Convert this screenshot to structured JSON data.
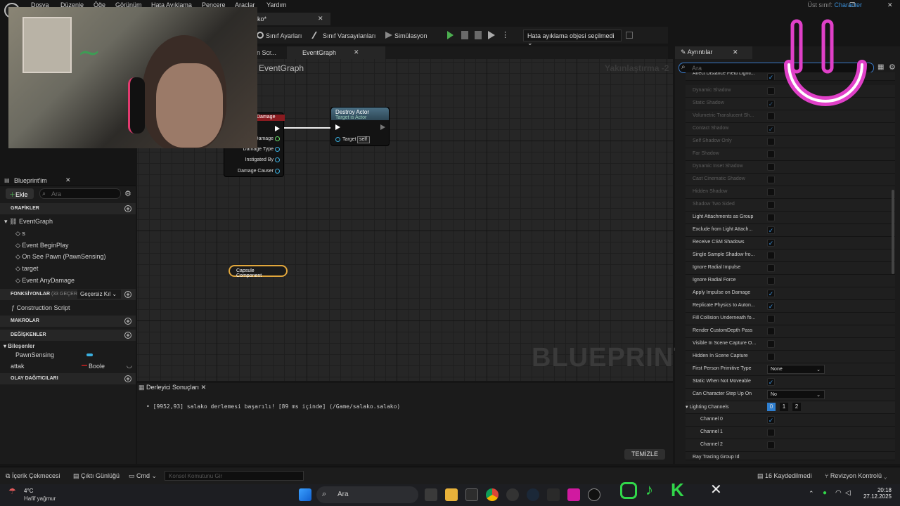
{
  "menu": [
    "Dosya",
    "Düzenle",
    "Öğe",
    "Görünüm",
    "Hata Ayıklama",
    "Pencere",
    "Araçlar",
    "Yardım"
  ],
  "parent_class": {
    "label": "Üst sınıf:",
    "value": "Character"
  },
  "doc_tab": "ko*",
  "toolbar": {
    "class_settings": "Sınıf Ayarları",
    "class_defaults": "Sınıf Varsayılanları",
    "simulation": "Simülasyon",
    "debug_object": "Hata ayıklama objesi seçilmedi"
  },
  "graph_tabs": [
    "on Scr...",
    "EventGraph"
  ],
  "graph": {
    "title": "EventGraph",
    "zoom": "Yakınlaştırma -2",
    "watermark": "BLUEPRINT",
    "nodes": {
      "destroy_title": "Destroy Actor",
      "destroy_sub": "Target is Actor",
      "target_label": "Target",
      "target_value": "self",
      "damage_header": "Damage",
      "damage_pins": [
        "Damage",
        "Damage Type",
        "Instigated By",
        "Damage Causer"
      ],
      "capsule": "Capsule Component"
    }
  },
  "left": {
    "tab": "Blueprint'im",
    "add": "Ekle",
    "search_placeholder": "Ara",
    "graphs_header": "GRAFİKLER",
    "event_graph": "EventGraph",
    "graph_items": [
      "s",
      "Event BeginPlay",
      "On See Pawn (PawnSensing)",
      "target",
      "Event AnyDamage"
    ],
    "functions_header": "FONKSİYONLAR",
    "functions_count": "(33 GEÇERSİZ)",
    "override": "Geçersiz Kıl",
    "construction": "Construction Script",
    "macros": "MAKROLAR",
    "variables": "DEĞİŞKENLER",
    "components": "Bileşenler",
    "pawnsensing": "PawnSensing",
    "attak": "attak",
    "attak_type": "Boole",
    "dispatchers": "OLAY DAĞITICILARI"
  },
  "output": {
    "tab": "Derleyici Sonuçları",
    "line": "[9952,93] salako derlemesi başarılı! [89 ms içinde] (/Game/salako.salako)",
    "clear": "TEMİZLE"
  },
  "details": {
    "tab": "Ayrıntılar",
    "search_placeholder": "Ara",
    "rows": [
      {
        "label": "Affect Distance Field Lighti...",
        "checked": true,
        "disabled": false
      },
      {
        "label": "Dynamic Shadow",
        "checked": false,
        "disabled": true
      },
      {
        "label": "Static Shadow",
        "checked": true,
        "disabled": true
      },
      {
        "label": "Volumetric Translucent Sh...",
        "checked": false,
        "disabled": true
      },
      {
        "label": "Contact Shadow",
        "checked": true,
        "disabled": true
      },
      {
        "label": "Self Shadow Only",
        "checked": false,
        "disabled": true
      },
      {
        "label": "Far Shadow",
        "checked": false,
        "disabled": true
      },
      {
        "label": "Dynamic Inset Shadow",
        "checked": false,
        "disabled": true
      },
      {
        "label": "Cast Cinematic Shadow",
        "checked": false,
        "disabled": true
      },
      {
        "label": "Hidden Shadow",
        "checked": false,
        "disabled": true
      },
      {
        "label": "Shadow Two Sided",
        "checked": false,
        "disabled": true
      },
      {
        "label": "Light Attachments as Group",
        "checked": false,
        "disabled": false
      },
      {
        "label": "Exclude from Light Attach...",
        "checked": true,
        "disabled": false
      },
      {
        "label": "Receive CSM Shadows",
        "checked": true,
        "disabled": false
      },
      {
        "label": "Single Sample Shadow fro...",
        "checked": false,
        "disabled": false
      },
      {
        "label": "Ignore Radial Impulse",
        "checked": false,
        "disabled": false
      },
      {
        "label": "Ignore Radial Force",
        "checked": false,
        "disabled": false
      },
      {
        "label": "Apply Impulse on Damage",
        "checked": true,
        "disabled": false
      },
      {
        "label": "Replicate Physics to Auton...",
        "checked": true,
        "disabled": false
      },
      {
        "label": "Fill Collision Underneath fo...",
        "checked": false,
        "disabled": false
      },
      {
        "label": "Render CustomDepth Pass",
        "checked": false,
        "disabled": false
      },
      {
        "label": "Visible In Scene Capture O...",
        "checked": false,
        "disabled": false
      },
      {
        "label": "Hidden In Scene Capture",
        "checked": false,
        "disabled": false
      }
    ],
    "fp_type": {
      "label": "First Person Primitive Type",
      "value": "None"
    },
    "static_nm": {
      "label": "Static When Not Moveable",
      "checked": true
    },
    "step_up": {
      "label": "Can Character Step Up On",
      "value": "No"
    },
    "light_channels": {
      "label": "Lighting Channels",
      "chips": [
        "0",
        "1",
        "2"
      ],
      "channels": [
        {
          "label": "Channel 0",
          "checked": true
        },
        {
          "label": "Channel 1",
          "checked": false
        },
        {
          "label": "Channel 2",
          "checked": false
        }
      ]
    },
    "ray": "Ray Tracing Group Id"
  },
  "status": {
    "content": "İçerik Çekmecesi",
    "output_log": "Çıktı Günlüğü",
    "cmd": "Cmd",
    "console_placeholder": "Konsol Komutunu Gir",
    "saved": "16 Kaydedilmedi",
    "revision": "Revizyon Kontrolü"
  },
  "taskbar": {
    "temp": "4°C",
    "weather": "Hafif yağmur",
    "search": "Ara",
    "time": "20:18",
    "date": "27.12.2025"
  },
  "colors": {
    "accent": "#3a8fd9",
    "smile": "#e040c8",
    "play": "#4caf50"
  }
}
